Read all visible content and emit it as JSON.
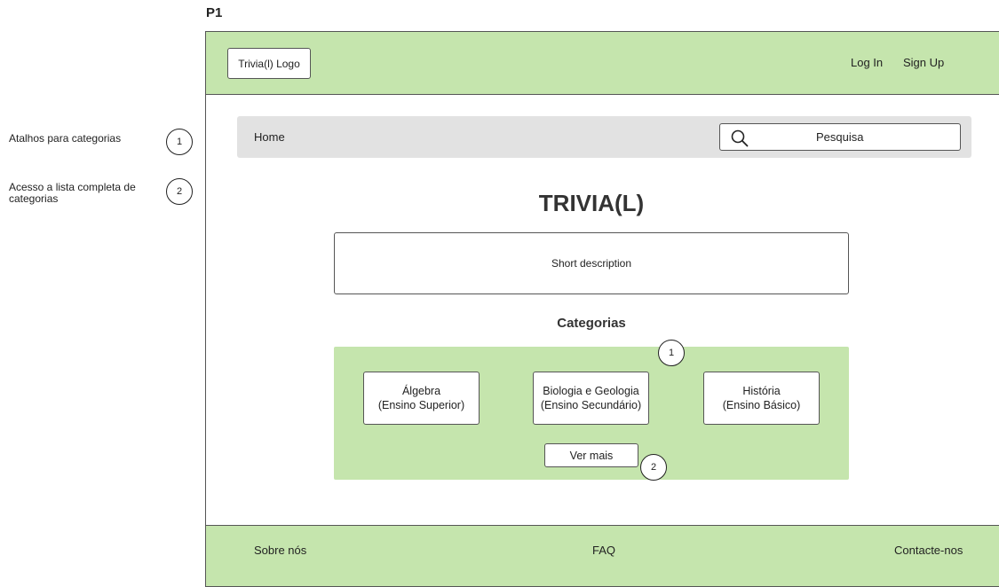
{
  "page_label": "P1",
  "legend": [
    {
      "text": "Atalhos para categorias",
      "number": "1"
    },
    {
      "text": "Acesso a lista completa de categorias",
      "number": "2"
    }
  ],
  "header": {
    "logo": "Trivia(l) Logo",
    "login": "Log In",
    "signup": "Sign Up"
  },
  "navbar": {
    "home": "Home",
    "search_placeholder": "Pesquisa"
  },
  "main": {
    "title": "TRIVIA(L)",
    "description": "Short description",
    "categories_title": "Categorias",
    "categories": [
      {
        "name": "Álgebra",
        "level": "(Ensino Superior)"
      },
      {
        "name": "Biologia e Geologia",
        "level": "(Ensino Secundário)"
      },
      {
        "name": "História",
        "level": "(Ensino Básico)"
      }
    ],
    "more_button": "Ver mais",
    "marker_categories": "1",
    "marker_more": "2"
  },
  "footer": {
    "about": "Sobre nós",
    "faq": "FAQ",
    "contact": "Contacte-nos"
  }
}
